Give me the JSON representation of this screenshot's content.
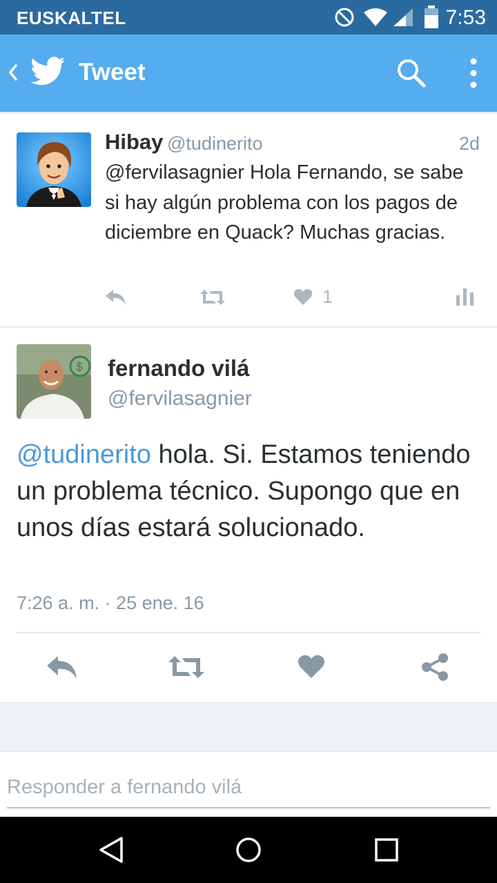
{
  "status_bar": {
    "carrier": "EUSKALTEL",
    "time": "7:53"
  },
  "app_bar": {
    "title": "Tweet"
  },
  "tweet1": {
    "name": "Hibay",
    "handle": "@tudinerito",
    "age": "2d",
    "text": "@fervilasagnier Hola Fernando, se sabe si hay algún problema con los pagos de diciembre en Quack? Muchas gracias.",
    "likes": "1"
  },
  "tweet2": {
    "name": "fernando vilá",
    "handle": "@fervilasagnier",
    "mention": "@tudinerito",
    "text": " hola. Si. Estamos teniendo un problema técnico. Supongo que en unos días estará solucionado.",
    "timestamp": "7:26 a. m. · 25 ene. 16"
  },
  "reply": {
    "placeholder": "Responder a fernando vilá"
  },
  "colors": {
    "status_bar": "#2b6aa0",
    "app_bar": "#55acee",
    "link": "#4a9ad6",
    "icon_gray": "#8899a6"
  }
}
